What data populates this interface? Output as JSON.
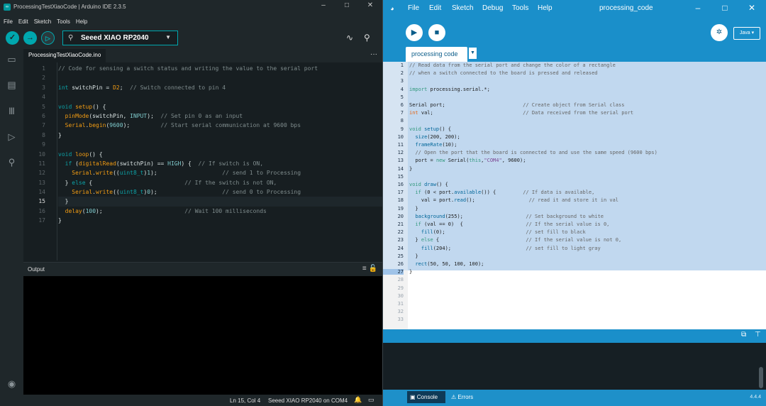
{
  "arduino": {
    "window_title": "ProcessingTestXiaoCode | Arduino IDE 2.3.5",
    "menu": [
      "File",
      "Edit",
      "Sketch",
      "Tools",
      "Help"
    ],
    "board": "Seeed XIAO RP2040",
    "tab": "ProcessingTestXiaoCode.ino",
    "line_numbers": [
      "1",
      "2",
      "3",
      "4",
      "5",
      "6",
      "7",
      "8",
      "9",
      "10",
      "11",
      "12",
      "13",
      "14",
      "15",
      "16",
      "17"
    ],
    "output_label": "Output",
    "status_position": "Ln 15, Col 4",
    "status_board": "Seeed XIAO RP2040 on COM4",
    "accent": "#00a7ae"
  },
  "processing": {
    "menu": [
      "File",
      "Edit",
      "Sketch",
      "Debug",
      "Tools",
      "Help"
    ],
    "window_title": "processing_code",
    "mode": "Java ▾",
    "tab": "processing code",
    "line_numbers": [
      "1",
      "2",
      "3",
      "4",
      "5",
      "6",
      "7",
      "8",
      "9",
      "10",
      "11",
      "12",
      "13",
      "14",
      "15",
      "16",
      "17",
      "18",
      "19",
      "20",
      "21",
      "22",
      "23",
      "24",
      "25",
      "26",
      "27",
      "28",
      "29",
      "30",
      "31",
      "32",
      "33"
    ],
    "console_label": "Console",
    "errors_label": "Errors",
    "version": "4.4.4",
    "accent": "#1e90c9"
  }
}
